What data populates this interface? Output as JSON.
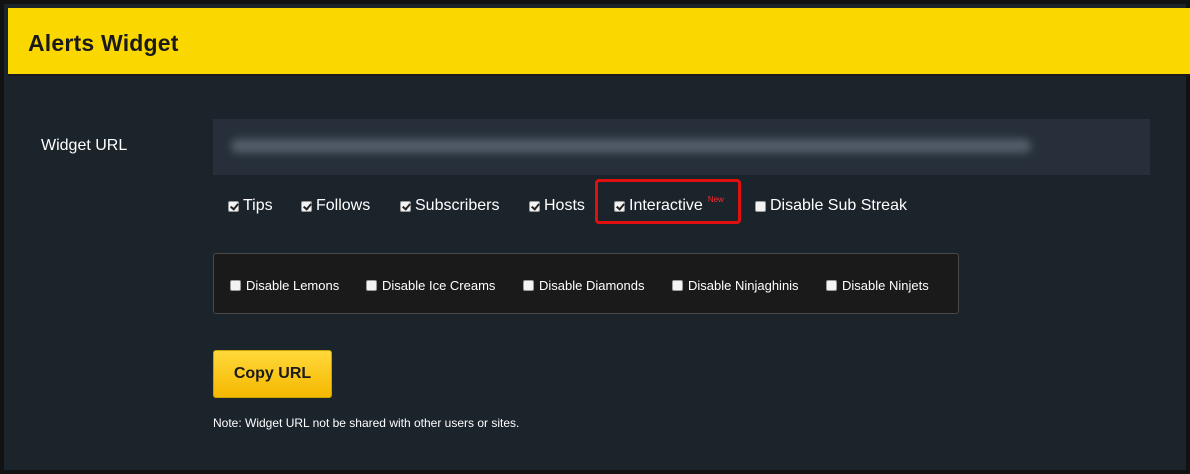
{
  "header": {
    "title": "Alerts Widget"
  },
  "widget_url": {
    "label": "Widget URL",
    "value_obscured": true
  },
  "alert_options": [
    {
      "label": "Tips",
      "checked": true
    },
    {
      "label": "Follows",
      "checked": true
    },
    {
      "label": "Subscribers",
      "checked": true
    },
    {
      "label": "Hosts",
      "checked": true
    },
    {
      "label": "Interactive",
      "checked": true,
      "badge": "New"
    },
    {
      "label": "Disable Sub Streak",
      "checked": false
    }
  ],
  "disable_options": [
    {
      "label": "Disable Lemons",
      "checked": false
    },
    {
      "label": "Disable Ice Creams",
      "checked": false
    },
    {
      "label": "Disable Diamonds",
      "checked": false
    },
    {
      "label": "Disable Ninjaghinis",
      "checked": false
    },
    {
      "label": "Disable Ninjets",
      "checked": false
    }
  ],
  "copy_button": {
    "label": "Copy URL"
  },
  "note": "Note: Widget URL not be shared with other users or sites.",
  "colors": {
    "header_bg": "#fbd700",
    "page_bg": "#1b232b",
    "highlight": "#e01010",
    "badge": "#ff2a2a",
    "button": "#f5b800"
  }
}
